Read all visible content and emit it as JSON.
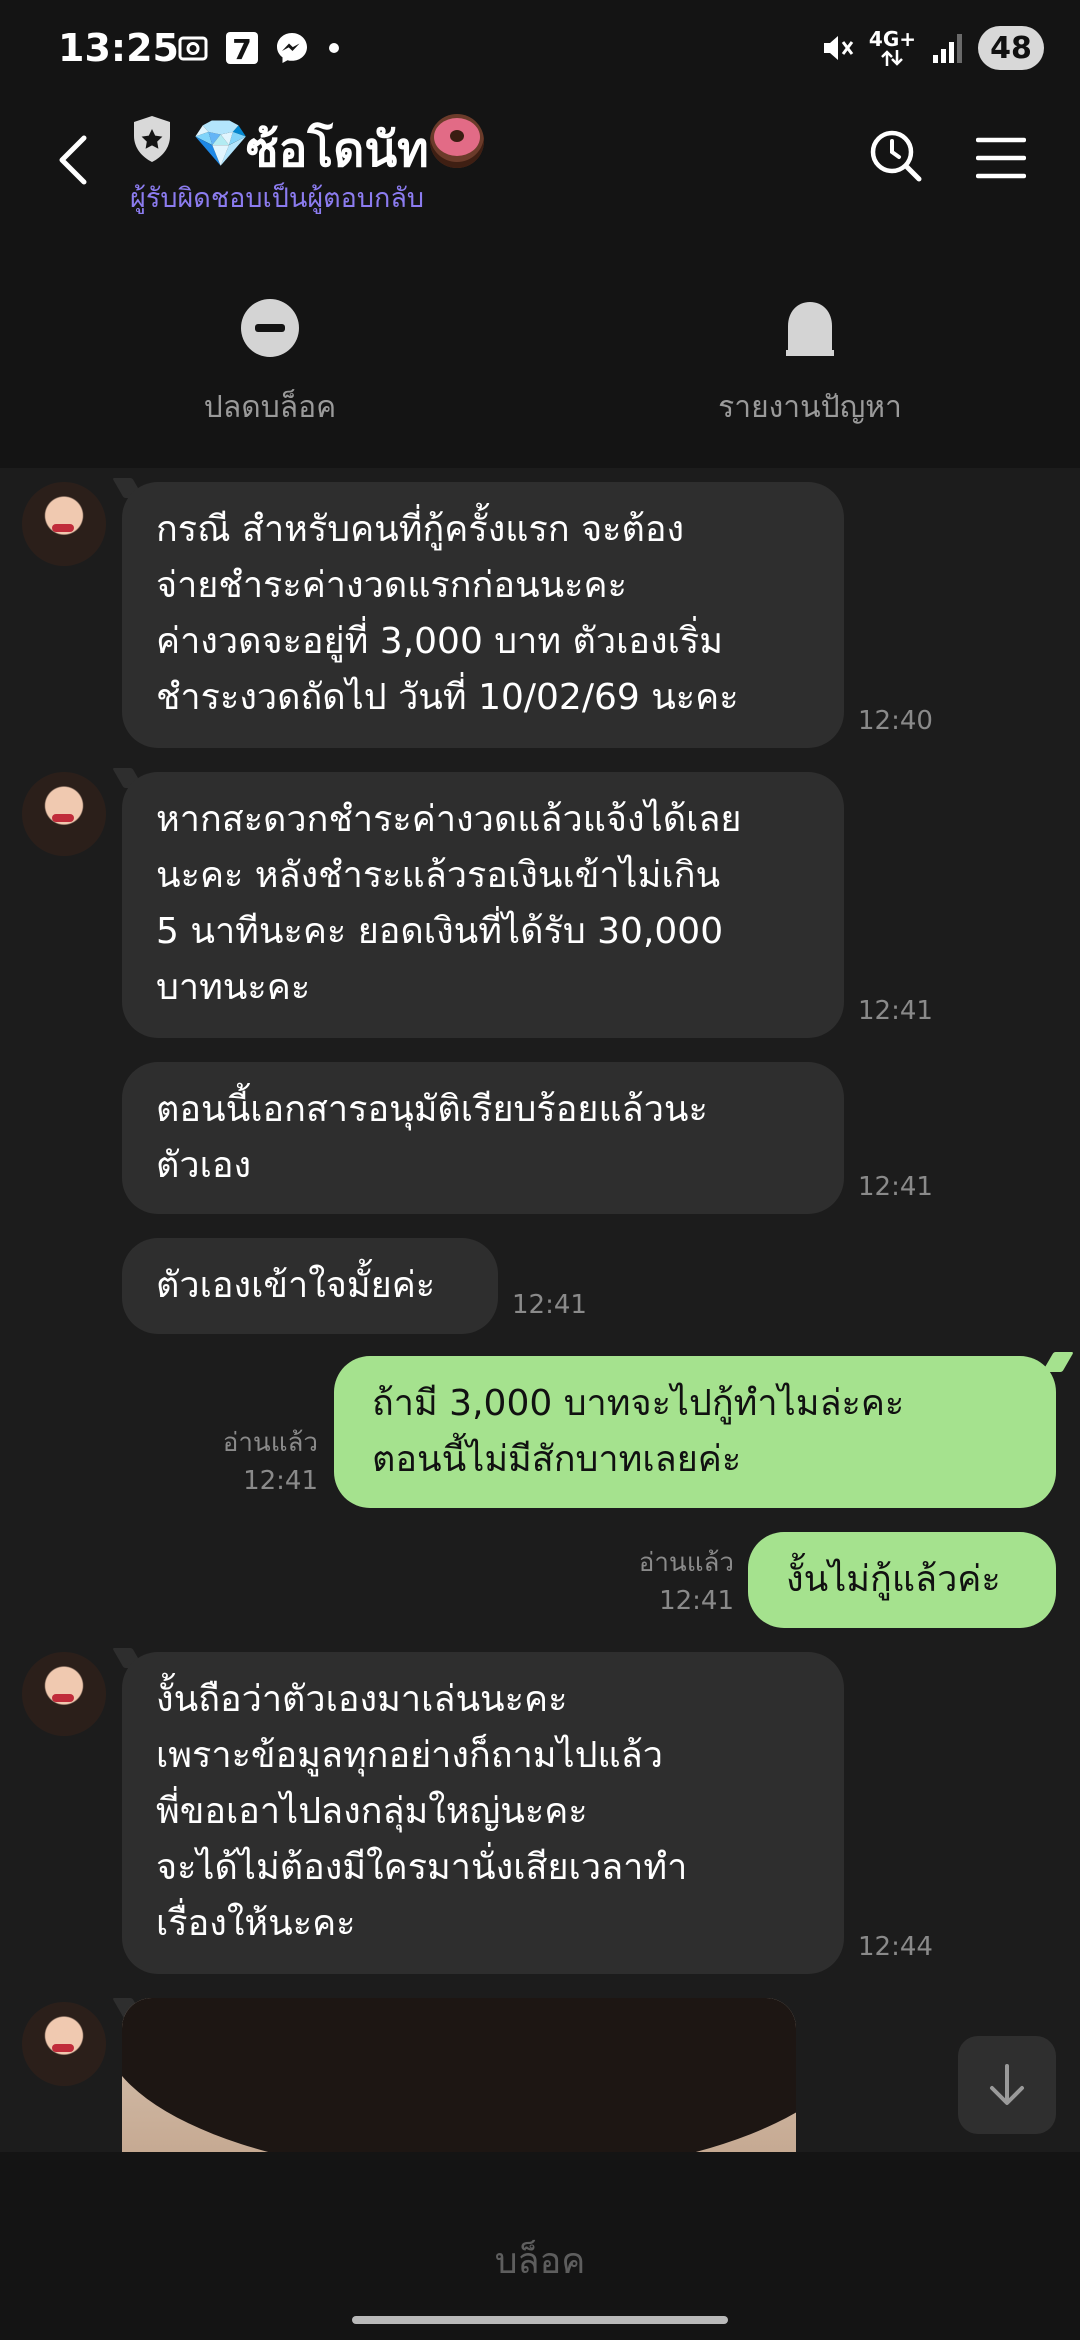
{
  "status_bar": {
    "time": "13:25",
    "network": "4G+",
    "battery": "48",
    "icons": [
      "screenshot-icon",
      "seven-eleven-icon",
      "messenger-icon",
      "dot-icon",
      "mute-icon",
      "data-arrows-icon",
      "signal-icon"
    ]
  },
  "header": {
    "title": "ซ้อโดนัท",
    "subtitle": "ผู้รับผิดชอบเป็นผู้ตอบกลับ",
    "badges": [
      "shield-icon",
      "diamond-icon",
      "donut-icon"
    ]
  },
  "actions": {
    "unblock_label": "ปลดบล็อค",
    "report_label": "รายงานปัญหา"
  },
  "messages": [
    {
      "side": "in",
      "lines": [
        "กรณี สำหรับคนที่กู้ครั้งแรก จะต้อง",
        "จ่ายชำระค่างวดแรกก่อนนะคะ",
        "ค่างวดจะอยู่ที่ 3,000 บาท ตัวเองเริ่ม",
        "ชำระงวดถัดไป วันที่ 10/02/69 นะคะ"
      ],
      "time": "12:40"
    },
    {
      "side": "in",
      "lines": [
        "หากสะดวกชำระค่างวดแล้วแจ้งได้เลย",
        "นะคะ หลังชำระแล้วรอเงินเข้าไม่เกิน",
        "5 นาทีนะคะ ยอดเงินที่ได้รับ 30,000",
        "บาทนะคะ"
      ],
      "time": "12:41"
    },
    {
      "side": "in",
      "lines": [
        "ตอนนี้เอกสารอนุมัติเรียบร้อยแล้วนะ",
        "ตัวเอง"
      ],
      "time": "12:41"
    },
    {
      "side": "in",
      "lines": [
        "ตัวเองเข้าใจมั้ยค่ะ"
      ],
      "time": "12:41"
    },
    {
      "side": "out",
      "lines": [
        "ถ้ามี 3,000 บาทจะไปกู้ทำไมล่ะคะ",
        "ตอนนี้ไม่มีสักบาทเลยค่ะ"
      ],
      "read": "อ่านแล้ว",
      "time": "12:41"
    },
    {
      "side": "out",
      "lines": [
        "งั้นไม่กู้แล้วค่ะ"
      ],
      "read": "อ่านแล้ว",
      "time": "12:41"
    },
    {
      "side": "in",
      "lines": [
        "งั้นถือว่าตัวเองมาเล่นนะคะ",
        "เพราะข้อมูลทุกอย่างก็ถามไปแล้ว",
        "พี่ขอเอาไปลงกลุ่มใหญ่นะคะ",
        "จะได้ไม่ต้องมีใครมานั่งเสียเวลาทำ",
        "เรื่องให้นะคะ"
      ],
      "time": "12:44"
    }
  ],
  "bottom": {
    "block_label": "บล็อค"
  }
}
